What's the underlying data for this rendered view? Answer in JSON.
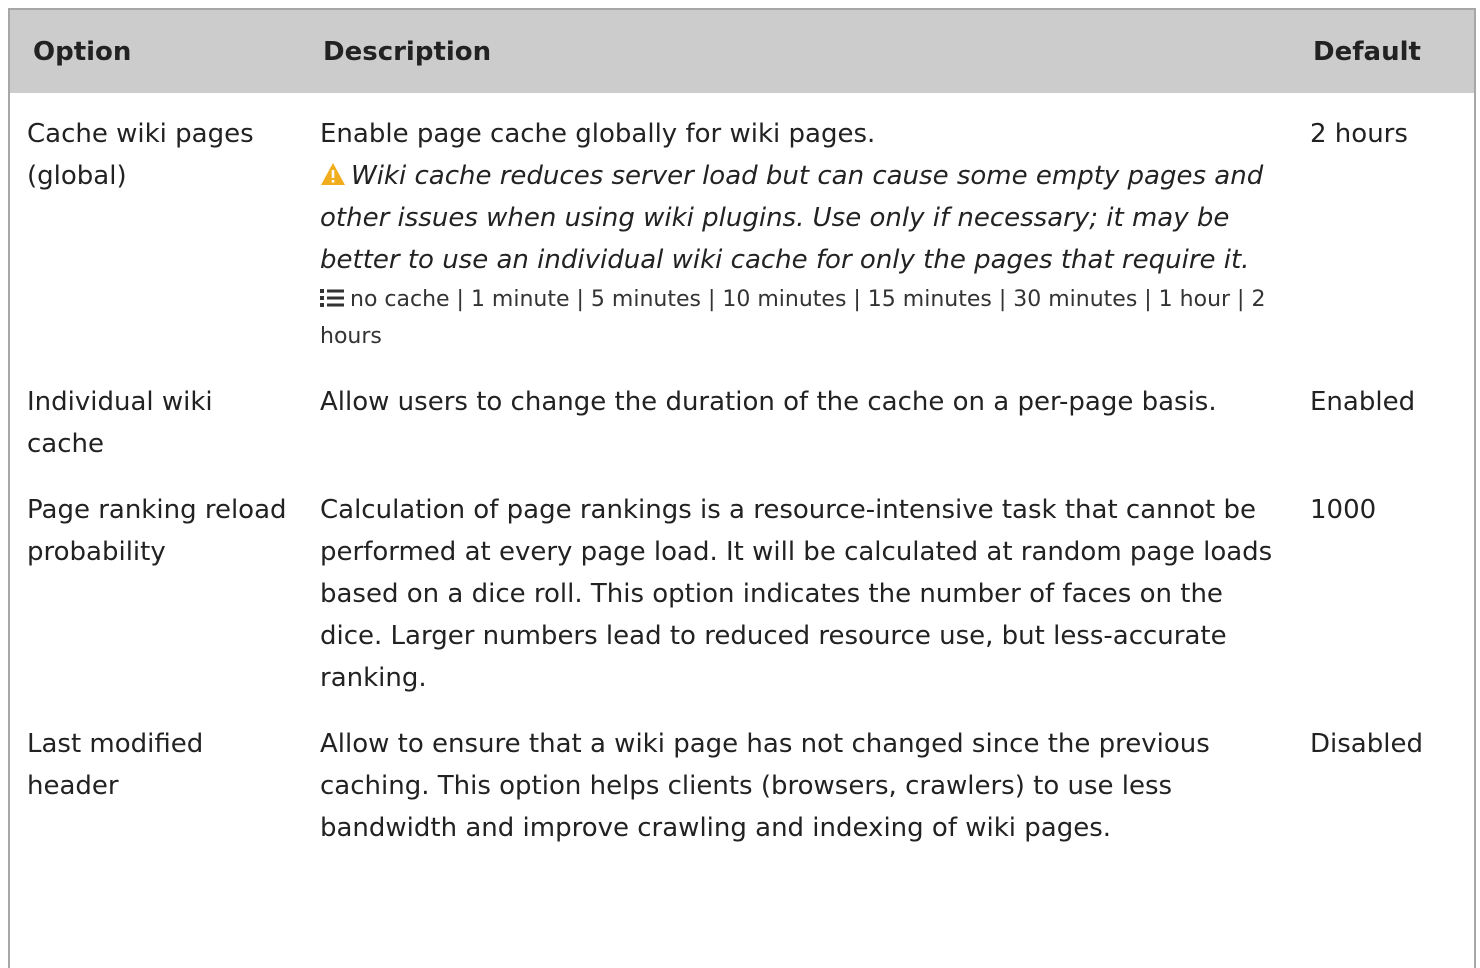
{
  "table": {
    "headers": {
      "option": "Option",
      "description": "Description",
      "default": "Default"
    },
    "rows": [
      {
        "option": "Cache wiki pages (global)",
        "description": "Enable page cache globally for wiki pages.",
        "warning": "Wiki cache reduces server load but can cause some empty pages and other issues when using wiki plugins. Use only if necessary; it may be better to use an individual wiki cache for only the pages that require it.",
        "options_list": "no cache | 1 minute | 5 minutes | 10 minutes | 15 minutes | 30 minutes | 1 hour | 2 hours",
        "default": "2 hours"
      },
      {
        "option": "Individual wiki cache",
        "description": "Allow users to change the duration of the cache on a per-page basis.",
        "default": "Enabled"
      },
      {
        "option": "Page ranking reload probability",
        "description": "Calculation of page rankings is a resource-intensive task that cannot be performed at every page load. It will be calculated at random page loads based on a dice roll. This option indicates the number of faces on the dice. Larger numbers lead to reduced resource use, but less-accurate ranking.",
        "default": "1000"
      },
      {
        "option": "Last modified header",
        "description": "Allow to ensure that a wiki page has not changed since the previous caching. This option helps clients (browsers, crawlers) to use less bandwidth and improve crawling and indexing of wiki pages.",
        "default": "Disabled"
      }
    ]
  },
  "icons": {
    "warning": "warning-triangle-icon",
    "list": "list-icon"
  },
  "colors": {
    "header_bg": "#cccccc",
    "warning_icon": "#f0ad1e",
    "text": "#222222"
  }
}
